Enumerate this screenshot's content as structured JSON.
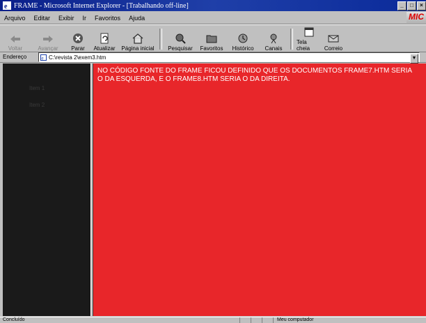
{
  "window": {
    "title": "FRAME - Microsoft Internet Explorer - [Trabalhando off-line]",
    "controls": [
      "_",
      "□",
      "×"
    ]
  },
  "menu": {
    "items": [
      "Arquivo",
      "Editar",
      "Exibir",
      "Ir",
      "Favoritos",
      "Ajuda"
    ],
    "brand": "MIC"
  },
  "toolbar": {
    "back": "Voltar",
    "forward": "Avançar",
    "stop": "Parar",
    "refresh": "Atualizar",
    "home": "Página inicial",
    "search": "Pesquisar",
    "favorites": "Favoritos",
    "history": "Histórico",
    "channels": "Canais",
    "fullscreen": "Tela cheia",
    "mail": "Correio"
  },
  "address": {
    "label": "Endereço",
    "value": "C:\\revista 2\\exem3.htm"
  },
  "left_frame": {
    "links": [
      "Item 1",
      "Item 2"
    ]
  },
  "right_frame": {
    "message": "NO CÓDIGO FONTE DO FRAME FICOU DEFINIDO QUE OS DOCUMENTOS FRAME7.HTM SERIA O DA ESQUERDA, E O FRAME8.HTM SERIA O DA DIREITA.",
    "background_color": "#e8262a"
  },
  "status": {
    "left": "Concluído",
    "zone": "Meu computador"
  },
  "colors": {
    "titlebar": "#0a1f8a",
    "left_frame_bg": "#1a1a1a",
    "chrome": "#c0c0c0"
  }
}
